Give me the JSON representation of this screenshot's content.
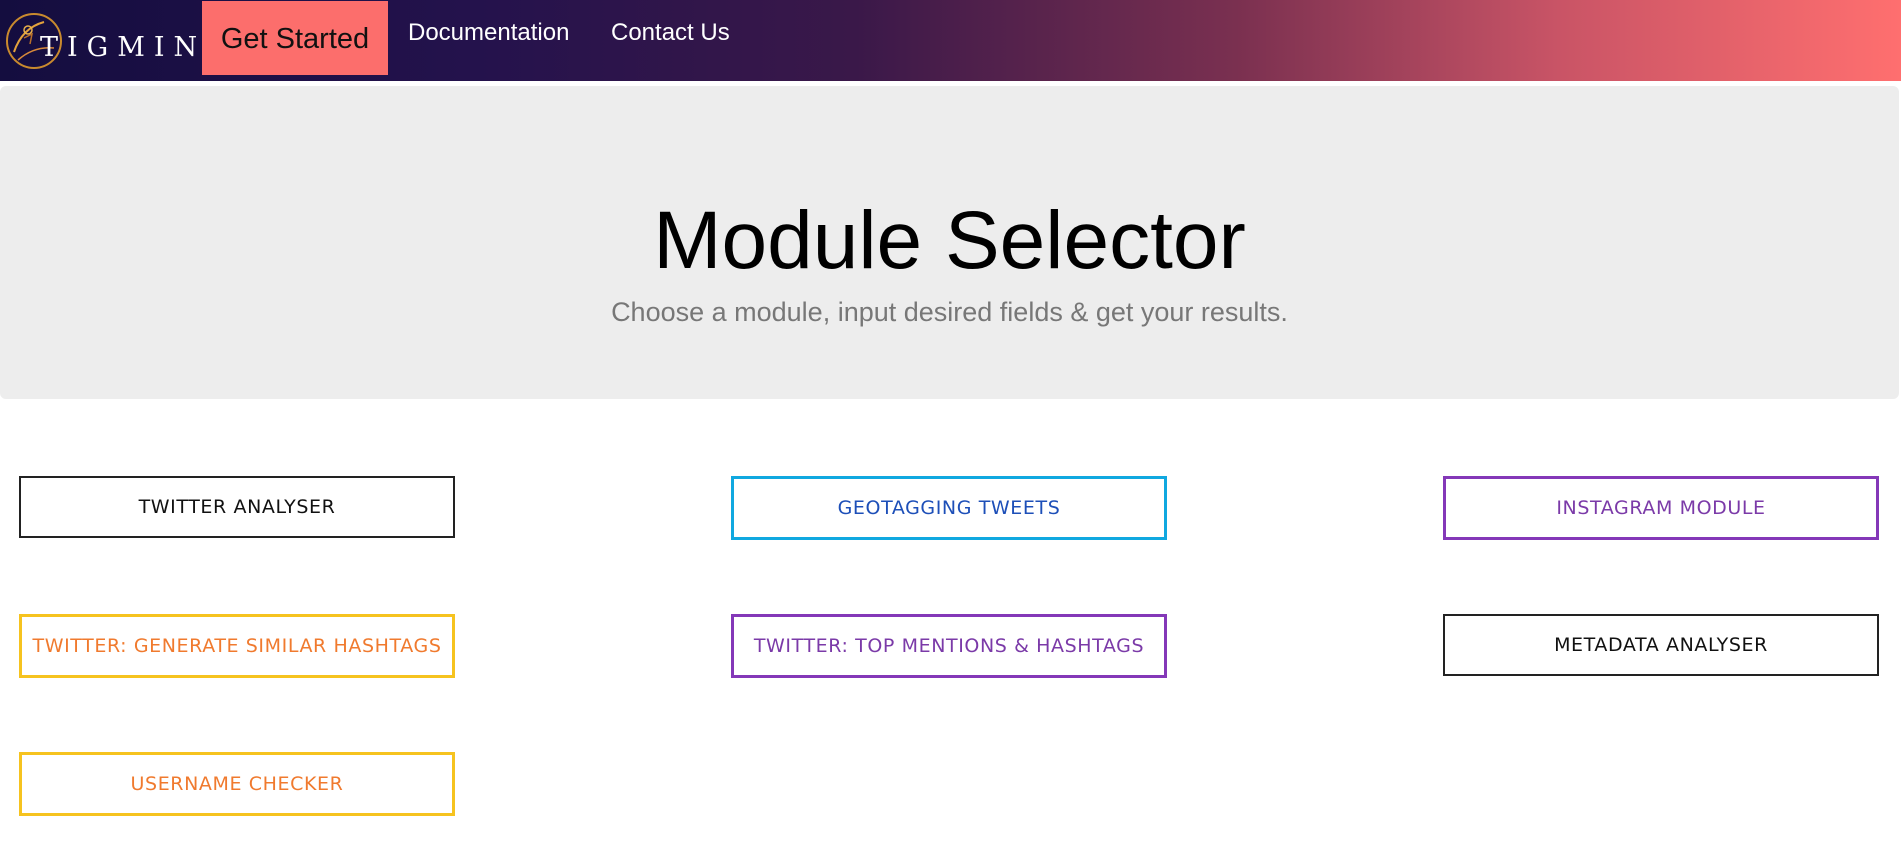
{
  "navbar": {
    "brand": "TIGMINT",
    "cta_label": "Get Started",
    "links": [
      "Documentation",
      "Contact Us"
    ]
  },
  "hero": {
    "title": "Module Selector",
    "subtitle": "Choose a module, input desired fields & get your results."
  },
  "modules": [
    {
      "label": "TWITTER ANALYSER",
      "border_color": "#222222",
      "text_color": "#111111"
    },
    {
      "label": "GEOTAGGING TWEETS",
      "border_color": "#10a8e0",
      "text_color": "#1d4fb8"
    },
    {
      "label": "INSTAGRAM MODULE",
      "border_color": "#8438b8",
      "text_color": "#7b3aa8"
    },
    {
      "label": "TWITTER: GENERATE SIMILAR HASHTAGS",
      "border_color": "#f6c31f",
      "text_color": "#f07a2e"
    },
    {
      "label": "TWITTER: TOP MENTIONS & HASHTAGS",
      "border_color": "#8438b8",
      "text_color": "#7b3aa8"
    },
    {
      "label": "METADATA ANALYSER",
      "border_color": "#222222",
      "text_color": "#111111"
    },
    {
      "label": "USERNAME CHECKER",
      "border_color": "#f6c31f",
      "text_color": "#f07a2e"
    }
  ],
  "colors": {
    "navbar_gradient_start": "#140d3f",
    "navbar_gradient_end": "#ff6f6f",
    "cta_background": "#fc6e6c",
    "hero_background": "#ededed"
  },
  "icons": {
    "brand_logo": "tigmint-logo-icon"
  }
}
